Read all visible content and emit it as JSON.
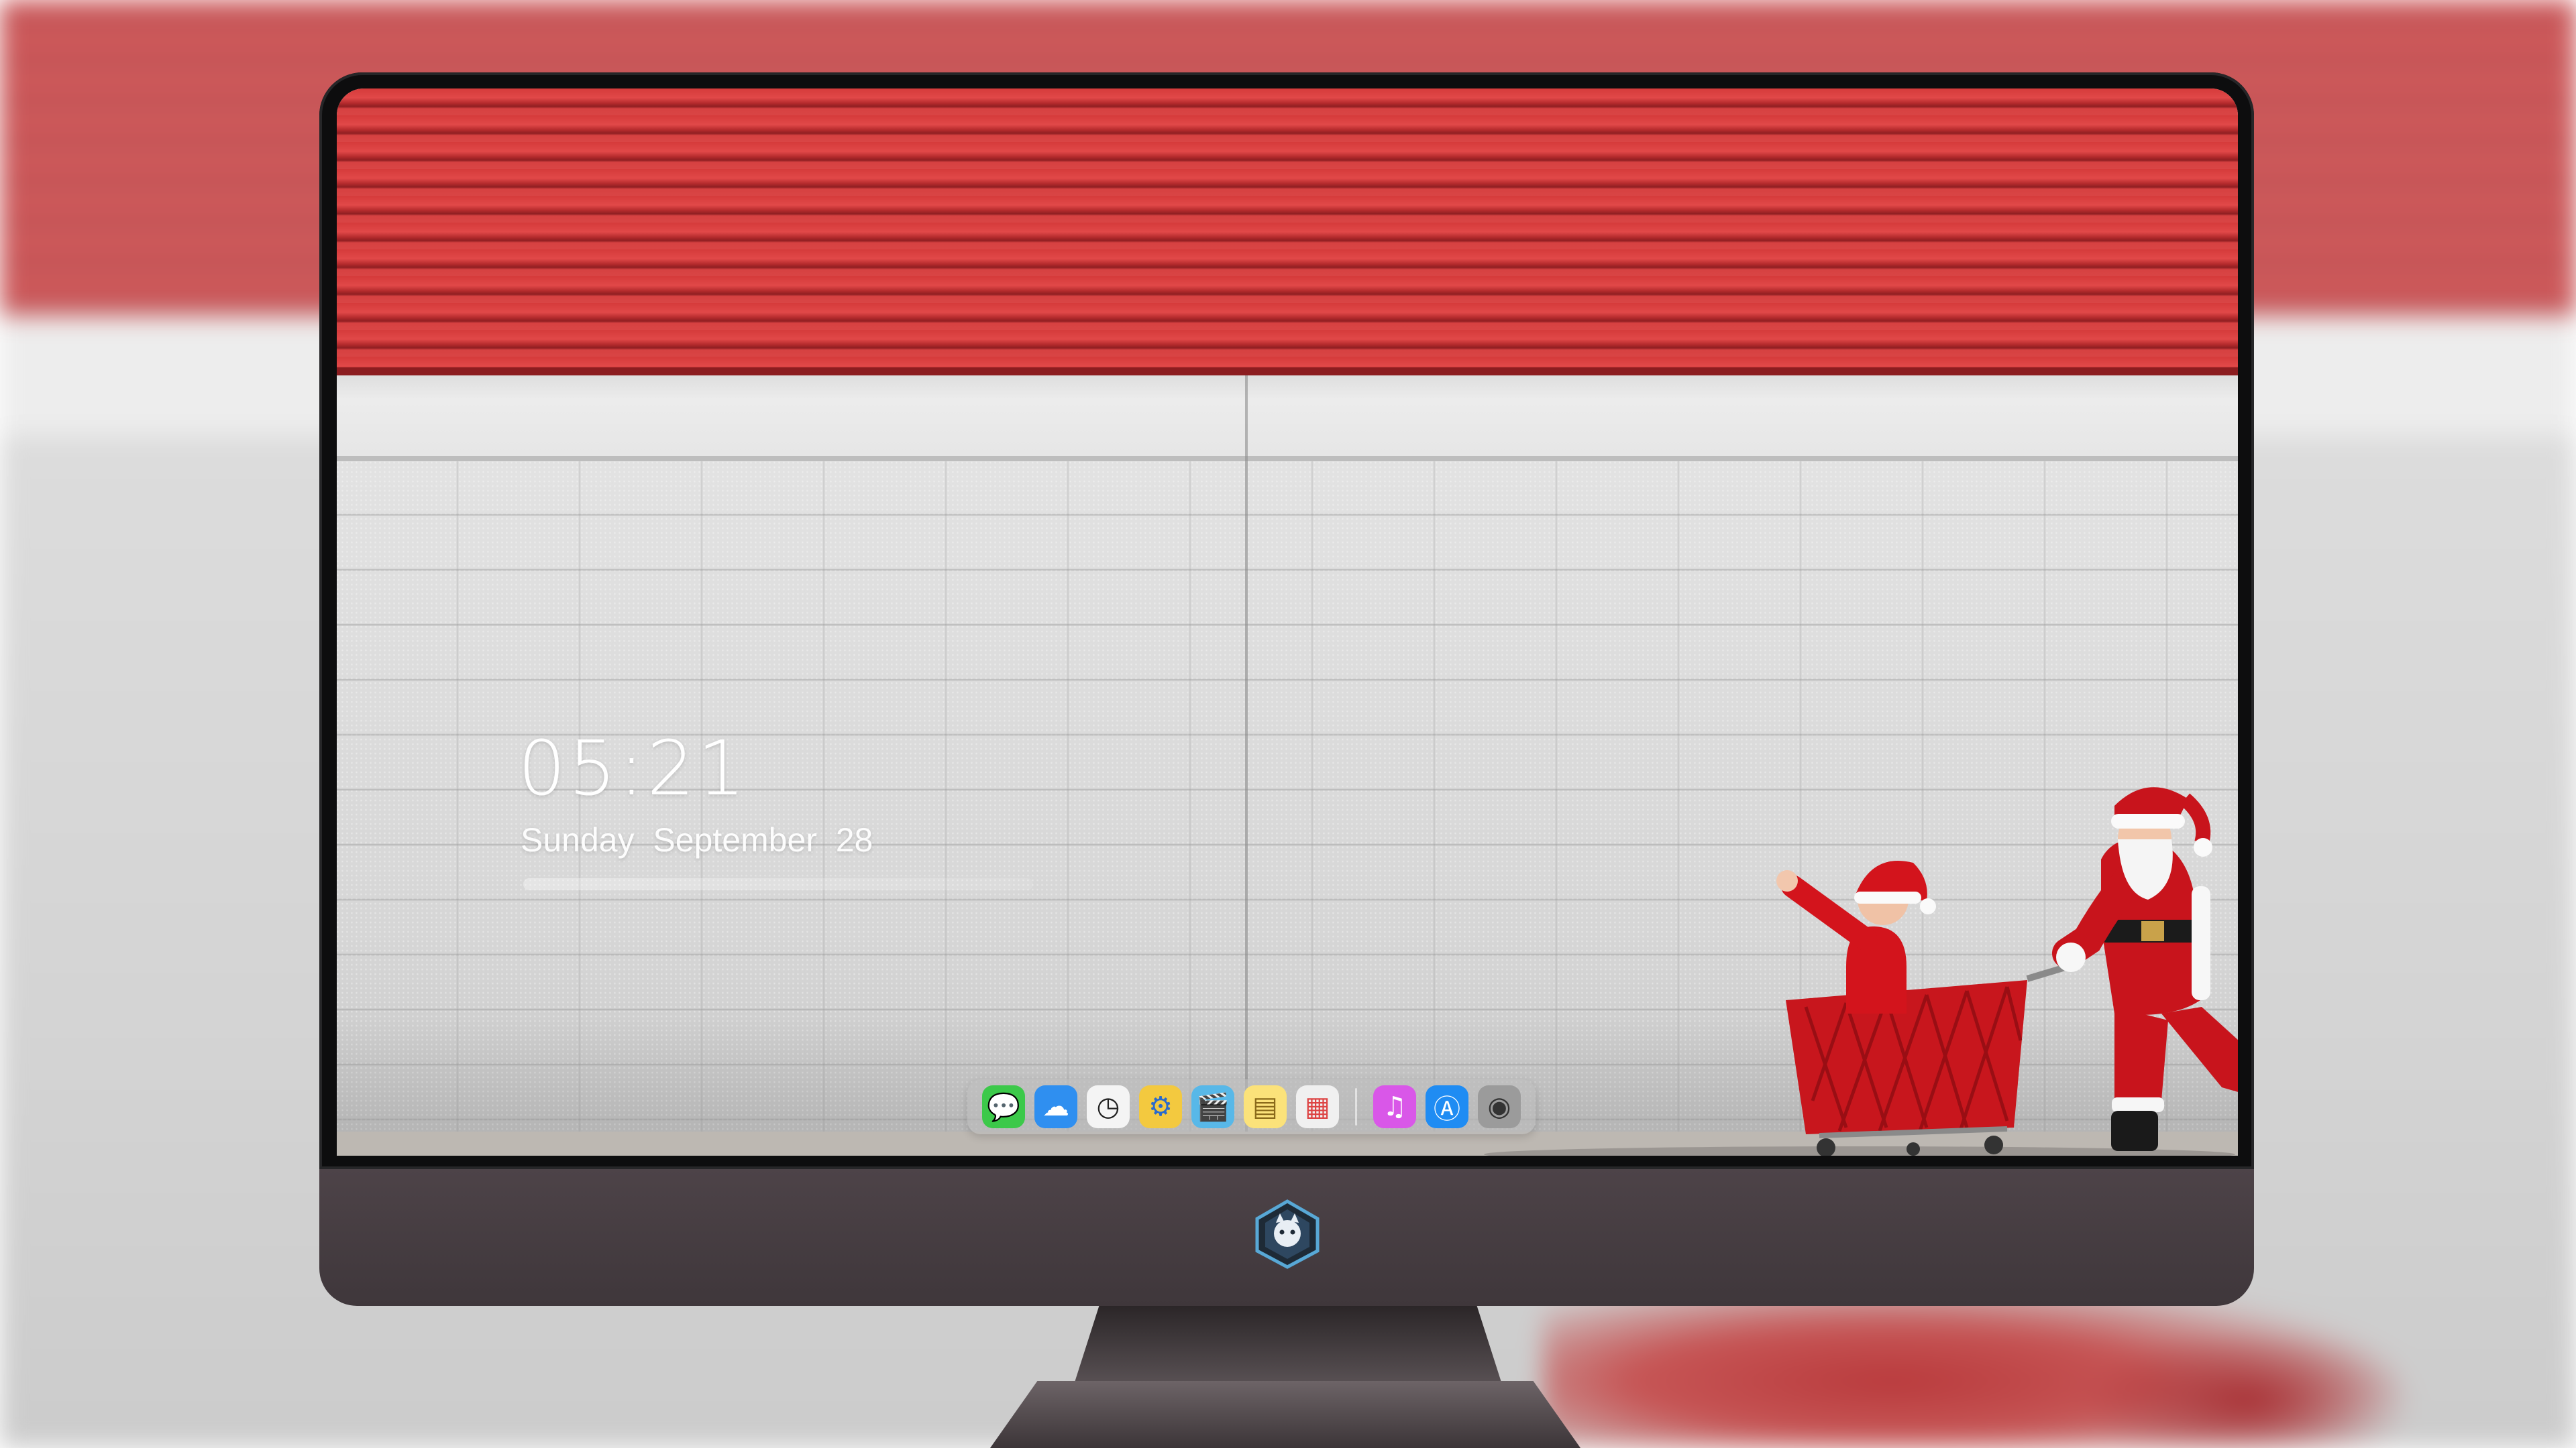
{
  "lockscreen": {
    "time": "05:21",
    "date": "Sunday  September  28"
  },
  "dock": {
    "apps": [
      {
        "name": "messages-icon",
        "glyph": "💬",
        "bg": "#3cc94a"
      },
      {
        "name": "weather-icon",
        "glyph": "☁",
        "bg": "#2f8ff0"
      },
      {
        "name": "clock-icon",
        "glyph": "🕓",
        "bg": "#f4f4f4"
      },
      {
        "name": "finder-icon",
        "glyph": "⚙",
        "bg": "#f3c93f"
      },
      {
        "name": "video-icon",
        "glyph": "🎬",
        "bg": "#58b8e8"
      },
      {
        "name": "notes-icon",
        "glyph": "📝",
        "bg": "#fbe27a"
      },
      {
        "name": "photos-grid-icon",
        "glyph": "▦",
        "bg": "#f0f0f0"
      },
      {
        "name": "music-icon",
        "glyph": "♫",
        "bg": "#d957e8"
      },
      {
        "name": "app-store-icon",
        "glyph": "Ⓐ",
        "bg": "#1f8cf3"
      },
      {
        "name": "camera-icon",
        "glyph": "📷",
        "bg": "#9b9b9b"
      }
    ]
  },
  "colors": {
    "wall_red": "#d53a3a",
    "santa_red": "#c8141c",
    "bezel": "#0d0d0e",
    "chin": "#4d4348"
  }
}
